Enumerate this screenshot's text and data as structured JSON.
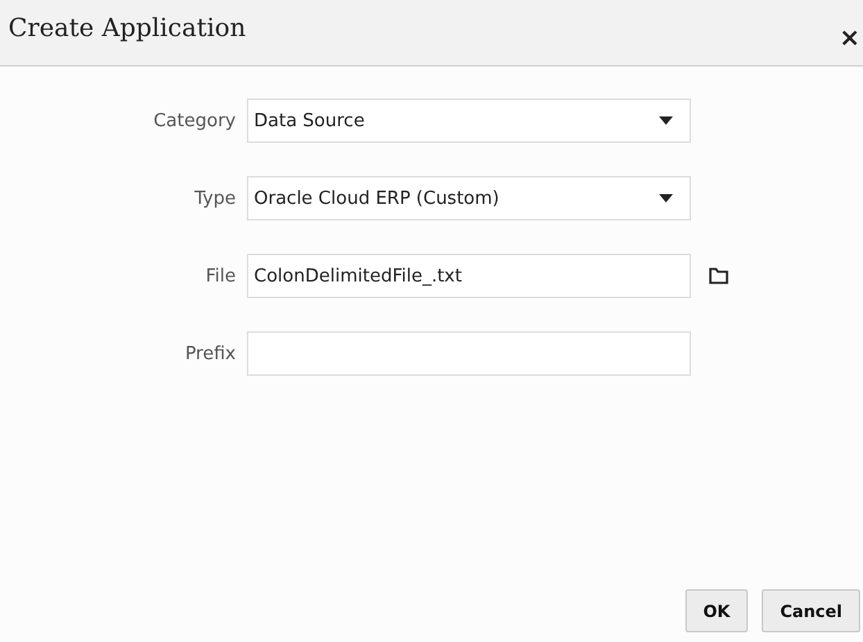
{
  "window": {
    "title": "Create Application",
    "close": "×"
  },
  "fields": [
    {
      "label": "Category",
      "kind": "select",
      "value": "Data Source"
    },
    {
      "label": "Type",
      "kind": "select",
      "value": "Oracle Cloud ERP (Custom)"
    },
    {
      "label": "File",
      "kind": "file",
      "value": "ColonDelimitedFile_.txt"
    },
    {
      "label": "Prefix",
      "kind": "text"
    }
  ],
  "buttons": [
    "OK",
    "Cancel"
  ]
}
